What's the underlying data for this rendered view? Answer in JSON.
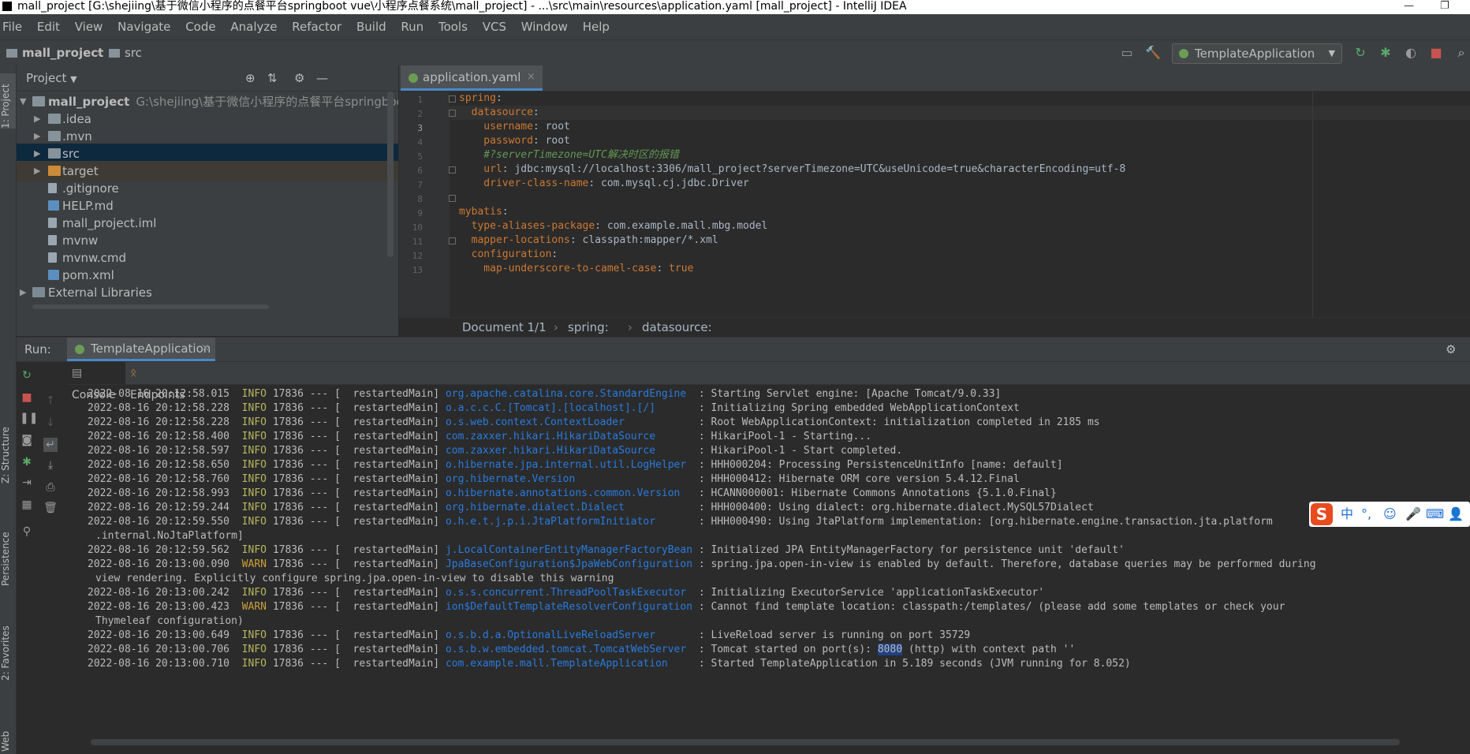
{
  "window": {
    "title": "mall_project [G:\\shejiing\\基于微信小程序的点餐平台springboot vue\\小程序点餐系统\\mall_project] - ...\\src\\main\\resources\\application.yaml [mall_project] - IntelliJ IDEA",
    "minimize": "—",
    "restore": "❐"
  },
  "menu": [
    "File",
    "Edit",
    "View",
    "Navigate",
    "Code",
    "Analyze",
    "Refactor",
    "Build",
    "Run",
    "Tools",
    "VCS",
    "Window",
    "Help"
  ],
  "breadcrumb": {
    "project": "mall_project",
    "folder": "src"
  },
  "toolbar": {
    "run_config": "TemplateApplication",
    "run_config_chevron": "▼",
    "search_icon": "⌕",
    "hammer": "🔨",
    "run": "↻",
    "debug": "✱",
    "coverage": "◐",
    "stop": "■",
    "layout": "▭"
  },
  "left_tabs": {
    "project": "1: Project",
    "structure": "Z: Structure",
    "persistence": "Persistence",
    "favorites": "2: Favorites",
    "web": "Web"
  },
  "project_panel": {
    "title": "Project",
    "title_chevron": "▼",
    "icons": {
      "locate": "⊕",
      "collapse": "⇅",
      "settings": "⚙",
      "hide": "—"
    },
    "tree": [
      {
        "name": "mall_project",
        "path": "G:\\shejiing\\基于微信小程序的点餐平台springboot",
        "expanded": true,
        "depth": 0,
        "arrow": "▼"
      },
      {
        "name": ".idea",
        "depth": 1,
        "arrow": "▶"
      },
      {
        "name": ".mvn",
        "depth": 1,
        "arrow": "▶"
      },
      {
        "name": "src",
        "depth": 1,
        "arrow": "▶",
        "selected": true
      },
      {
        "name": "target",
        "depth": 1,
        "arrow": "▶"
      },
      {
        "name": ".gitignore",
        "depth": 1,
        "arrow": ""
      },
      {
        "name": "HELP.md",
        "depth": 1,
        "arrow": ""
      },
      {
        "name": "mall_project.iml",
        "depth": 1,
        "arrow": ""
      },
      {
        "name": "mvnw",
        "depth": 1,
        "arrow": ""
      },
      {
        "name": "mvnw.cmd",
        "depth": 1,
        "arrow": ""
      },
      {
        "name": "pom.xml",
        "depth": 1,
        "arrow": ""
      },
      {
        "name": "External Libraries",
        "depth": 0,
        "arrow": "▶"
      }
    ]
  },
  "editor": {
    "tab_label": "application.yaml",
    "tab_close": "×",
    "lines": [
      {
        "n": "1",
        "key": "spring",
        "sep": ":",
        "val": ""
      },
      {
        "n": "2",
        "key": "  datasource",
        "sep": ":",
        "val": ""
      },
      {
        "n": "3",
        "key": "    username",
        "sep": ": ",
        "val": "root"
      },
      {
        "n": "4",
        "key": "    password",
        "sep": ": ",
        "val": "root"
      },
      {
        "n": "5",
        "comment": "    #?serverTimezone=UTC解决时区的报错"
      },
      {
        "n": "6",
        "key": "    url",
        "sep": ": ",
        "val": "jdbc:mysql://localhost:3306/mall_project?serverTimezone=UTC&useUnicode=true&characterEncoding=utf-8"
      },
      {
        "n": "7",
        "key": "    driver-class-name",
        "sep": ": ",
        "val": "com.mysql.cj.jdbc.Driver"
      },
      {
        "n": "8",
        "key": "",
        "sep": "",
        "val": ""
      },
      {
        "n": "9",
        "key": "mybatis",
        "sep": ":",
        "val": ""
      },
      {
        "n": "10",
        "key": "  type-aliases-package",
        "sep": ": ",
        "val": "com.example.mall.mbg.model"
      },
      {
        "n": "11",
        "key": "  mapper-locations",
        "sep": ": ",
        "val": "classpath:mapper/*.xml"
      },
      {
        "n": "12",
        "key": "  configuration",
        "sep": ":",
        "val": ""
      },
      {
        "n": "13",
        "key": "    map-underscore-to-camel-case",
        "sep": ": ",
        "val": "true"
      }
    ],
    "breadcrumb": {
      "doc": "Document 1/1",
      "sep1": "›",
      "item1": "spring:",
      "sep2": "›",
      "item2": "datasource:"
    }
  },
  "run_panel": {
    "label": "Run:",
    "tab_label": "TemplateApplication",
    "tab_close": "×",
    "gear": "⚙",
    "subtabs": {
      "console": "Console",
      "endpoints": "Endpoints"
    },
    "logs": [
      {
        "ts": "2022-08-16 20:12:58.015",
        "level": "INFO",
        "pid": "17836 --- [  restartedMain]",
        "logger": "org.apache.catalina.core.StandardEngine ",
        "msg": ": Starting Servlet engine: [Apache Tomcat/9.0.33]"
      },
      {
        "ts": "2022-08-16 20:12:58.228",
        "level": "INFO",
        "pid": "17836 --- [  restartedMain]",
        "logger": "o.a.c.c.C.[Tomcat].[localhost].[/]      ",
        "msg": ": Initializing Spring embedded WebApplicationContext"
      },
      {
        "ts": "2022-08-16 20:12:58.228",
        "level": "INFO",
        "pid": "17836 --- [  restartedMain]",
        "logger": "o.s.web.context.ContextLoader           ",
        "msg": ": Root WebApplicationContext: initialization completed in 2185 ms"
      },
      {
        "ts": "2022-08-16 20:12:58.400",
        "level": "INFO",
        "pid": "17836 --- [  restartedMain]",
        "logger": "com.zaxxer.hikari.HikariDataSource      ",
        "msg": ": HikariPool-1 - Starting..."
      },
      {
        "ts": "2022-08-16 20:12:58.597",
        "level": "INFO",
        "pid": "17836 --- [  restartedMain]",
        "logger": "com.zaxxer.hikari.HikariDataSource      ",
        "msg": ": HikariPool-1 - Start completed."
      },
      {
        "ts": "2022-08-16 20:12:58.650",
        "level": "INFO",
        "pid": "17836 --- [  restartedMain]",
        "logger": "o.hibernate.jpa.internal.util.LogHelper ",
        "msg": ": HHH000204: Processing PersistenceUnitInfo [name: default]"
      },
      {
        "ts": "2022-08-16 20:12:58.760",
        "level": "INFO",
        "pid": "17836 --- [  restartedMain]",
        "logger": "org.hibernate.Version                   ",
        "msg": ": HHH000412: Hibernate ORM core version 5.4.12.Final"
      },
      {
        "ts": "2022-08-16 20:12:58.993",
        "level": "INFO",
        "pid": "17836 --- [  restartedMain]",
        "logger": "o.hibernate.annotations.common.Version  ",
        "msg": ": HCANN000001: Hibernate Commons Annotations {5.1.0.Final}"
      },
      {
        "ts": "2022-08-16 20:12:59.244",
        "level": "INFO",
        "pid": "17836 --- [  restartedMain]",
        "logger": "org.hibernate.dialect.Dialect           ",
        "msg": ": HHH000400: Using dialect: org.hibernate.dialect.MySQL57Dialect"
      },
      {
        "ts": "2022-08-16 20:12:59.550",
        "level": "INFO",
        "pid": "17836 --- [  restartedMain]",
        "logger": "o.h.e.t.j.p.i.JtaPlatformInitiator      ",
        "msg": ": HHH000490: Using JtaPlatform implementation: [org.hibernate.engine.transaction.jta.platform",
        "cont": ".internal.NoJtaPlatform]"
      },
      {
        "ts": "2022-08-16 20:12:59.562",
        "level": "INFO",
        "pid": "17836 --- [  restartedMain]",
        "logger": "j.LocalContainerEntityManagerFactoryBean",
        "msg": ": Initialized JPA EntityManagerFactory for persistence unit 'default'"
      },
      {
        "ts": "2022-08-16 20:13:00.090",
        "level": "WARN",
        "pid": "17836 --- [  restartedMain]",
        "logger": "JpaBaseConfiguration$JpaWebConfiguration",
        "msg": ": spring.jpa.open-in-view is enabled by default. Therefore, database queries may be performed during",
        "cont": "view rendering. Explicitly configure spring.jpa.open-in-view to disable this warning"
      },
      {
        "ts": "2022-08-16 20:13:00.242",
        "level": "INFO",
        "pid": "17836 --- [  restartedMain]",
        "logger": "o.s.s.concurrent.ThreadPoolTaskExecutor ",
        "msg": ": Initializing ExecutorService 'applicationTaskExecutor'"
      },
      {
        "ts": "2022-08-16 20:13:00.423",
        "level": "WARN",
        "pid": "17836 --- [  restartedMain]",
        "logger": "ion$DefaultTemplateResolverConfiguration",
        "msg": ": Cannot find template location: classpath:/templates/ (please add some templates or check your",
        "cont": "Thymeleaf configuration)"
      },
      {
        "ts": "2022-08-16 20:13:00.649",
        "level": "INFO",
        "pid": "17836 --- [  restartedMain]",
        "logger": "o.s.b.d.a.OptionalLiveReloadServer      ",
        "msg": ": LiveReload server is running on port 35729"
      },
      {
        "ts": "2022-08-16 20:13:00.706",
        "level": "INFO",
        "pid": "17836 --- [  restartedMain]",
        "logger": "o.s.b.w.embedded.tomcat.TomcatWebServer ",
        "msg_pre": ": Tomcat started on port(s): ",
        "msg_hl": "8080",
        "msg": " (http) with context path ''"
      },
      {
        "ts": "2022-08-16 20:13:00.710",
        "level": "INFO",
        "pid": "17836 --- [  restartedMain]",
        "logger": "com.example.mall.TemplateApplication    ",
        "msg": ": Started TemplateApplication in 5.189 seconds (JVM running for 8.052)"
      }
    ]
  },
  "ime": {
    "logo": "S",
    "lang": "中",
    "punct": "°,",
    "emoji": "☺",
    "mic": "🎤",
    "keyboard": "⌨",
    "user": "👤"
  }
}
